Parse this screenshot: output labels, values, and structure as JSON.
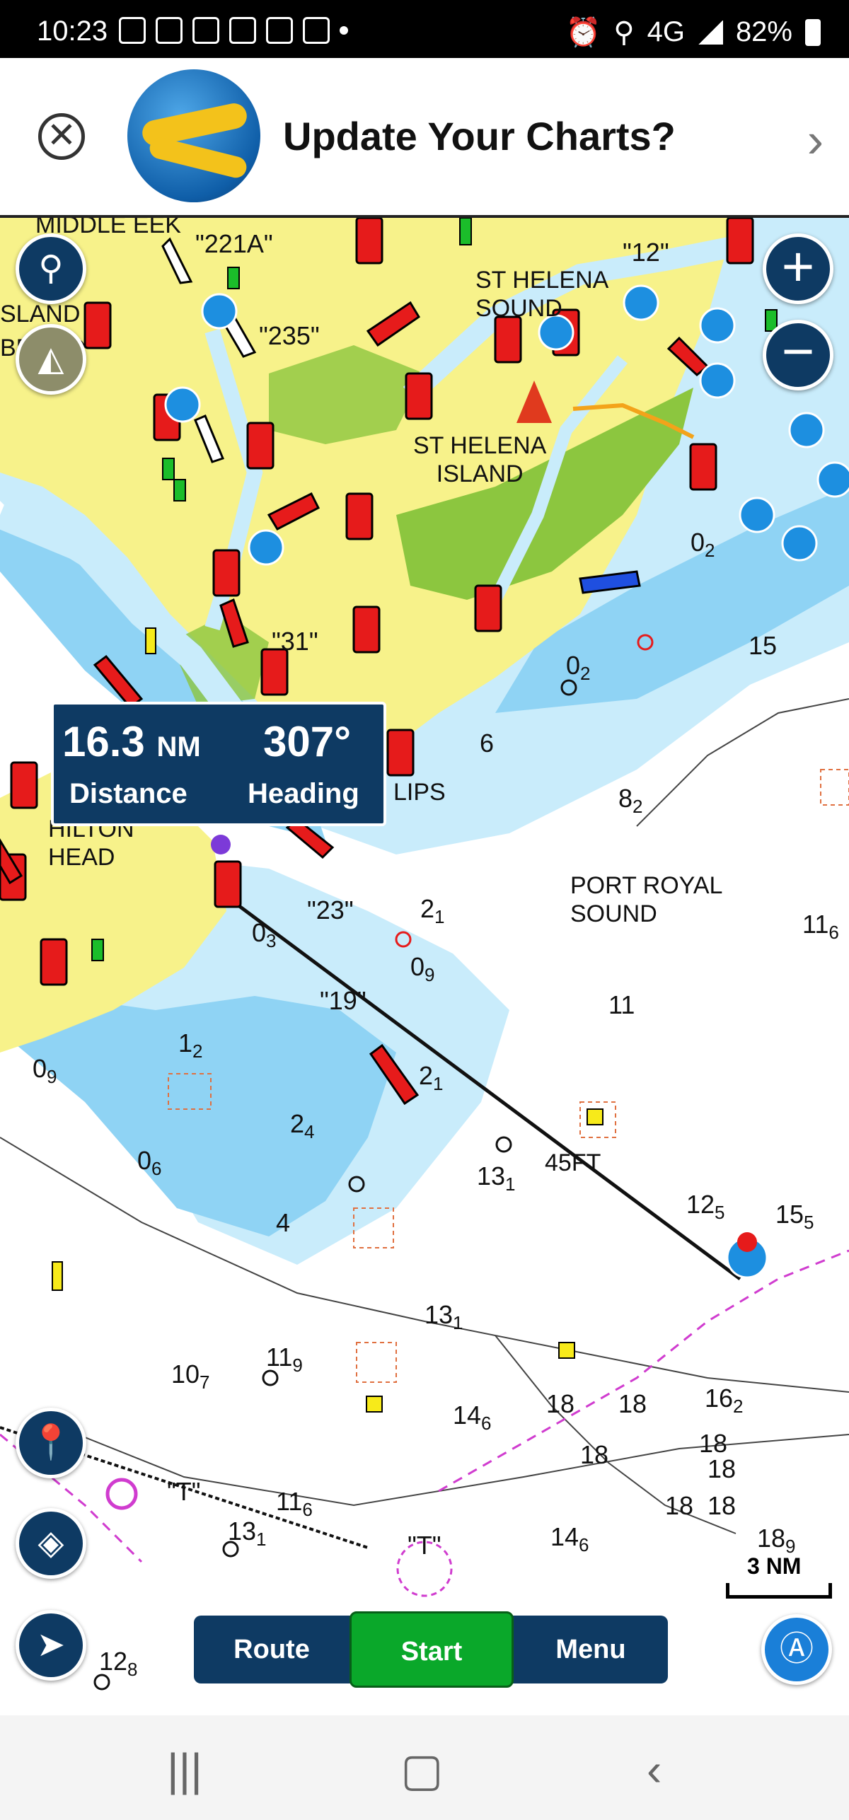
{
  "status_bar": {
    "time": "10:23",
    "network": "4G",
    "battery": "82%"
  },
  "banner": {
    "title": "Update Your Charts?"
  },
  "map": {
    "labels": {
      "st_helena_sound": "ST HELENA\nSOUND",
      "st_helena_island": "ST HELENA\nISLAND",
      "hilton_head": "HILTON\nHEAD",
      "port_royal_sound": "PORT ROYAL\nSOUND",
      "middle_creek": "MIDDLE\nEEK",
      "broad": "BROAD",
      "island": "SLAND",
      "lips": "LIPS",
      "ft45": "45FT"
    },
    "buoy_tags": [
      "\"221A\"",
      "\"235\"",
      "\"12\"",
      "\"31\"",
      "\"23\"",
      "\"19\"",
      "\"T\"",
      "\"T\""
    ],
    "soundings": [
      {
        "main": "16",
        "sub": "2"
      },
      {
        "main": "11",
        "sub": "6"
      },
      {
        "main": "11",
        "sub": ""
      },
      {
        "main": "12",
        "sub": "5"
      },
      {
        "main": "15",
        "sub": "5"
      },
      {
        "main": "13",
        "sub": "1"
      },
      {
        "main": "13",
        "sub": "1"
      },
      {
        "main": "10",
        "sub": "7"
      },
      {
        "main": "11",
        "sub": "9"
      },
      {
        "main": "14",
        "sub": "6"
      },
      {
        "main": "14",
        "sub": "6"
      },
      {
        "main": "18",
        "sub": ""
      },
      {
        "main": "18",
        "sub": ""
      },
      {
        "main": "18",
        "sub": ""
      },
      {
        "main": "18",
        "sub": ""
      },
      {
        "main": "18",
        "sub": ""
      },
      {
        "main": "18",
        "sub": ""
      },
      {
        "main": "18",
        "sub": ""
      },
      {
        "main": "18",
        "sub": "9"
      },
      {
        "main": "11",
        "sub": "6"
      },
      {
        "main": "13",
        "sub": "1"
      },
      {
        "main": "12",
        "sub": "8"
      },
      {
        "main": "8",
        "sub": "2"
      },
      {
        "main": "2",
        "sub": "1"
      },
      {
        "main": "2",
        "sub": "1"
      },
      {
        "main": "2",
        "sub": "4"
      },
      {
        "main": "1",
        "sub": "2"
      },
      {
        "main": "0",
        "sub": "6"
      },
      {
        "main": "0",
        "sub": "9"
      },
      {
        "main": "0",
        "sub": "3"
      },
      {
        "main": "0",
        "sub": "9"
      },
      {
        "main": "4",
        "sub": ""
      },
      {
        "main": "6",
        "sub": ""
      },
      {
        "main": "15",
        "sub": ""
      },
      {
        "main": "0",
        "sub": "2"
      },
      {
        "main": "0",
        "sub": "2"
      }
    ]
  },
  "info_box": {
    "distance_value": "16.3",
    "distance_unit": "NM",
    "distance_label": "Distance",
    "heading_value": "307°",
    "heading_label": "Heading"
  },
  "scale": {
    "label": "3 NM"
  },
  "bottom_bar": {
    "route": "Route",
    "start": "Start",
    "menu": "Menu"
  },
  "colors": {
    "land": "#f7f28a",
    "shallow": "#8fd3f4",
    "mid_water": "#c9ecfb",
    "deep": "#ffffff",
    "marsh": "#8cc63f",
    "panel": "#0e3a63",
    "start_green": "#0aa82a"
  }
}
